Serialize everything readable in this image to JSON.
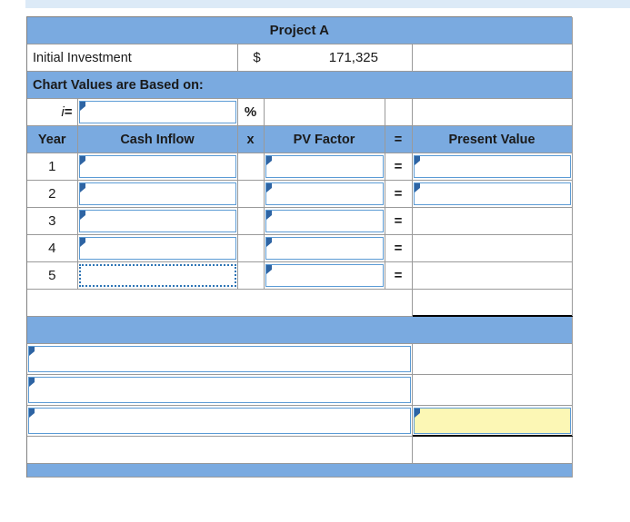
{
  "sheet": {
    "title": "Project A",
    "initial_investment": {
      "label": "Initial Investment",
      "currency_symbol": "$",
      "amount": "171,325"
    },
    "chart_values_note": "Chart Values are Based on:",
    "rate_row": {
      "label_i": "i",
      "label_eq": "=",
      "value": "",
      "unit": "%"
    },
    "columns": {
      "year": "Year",
      "cash_inflow": "Cash Inflow",
      "multiply": "x",
      "pv_factor": "PV Factor",
      "equals": "=",
      "present_value": "Present Value"
    },
    "rows": [
      {
        "year": "1",
        "cash_inflow": "",
        "op_x": "",
        "pv_factor": "",
        "op_eq": "=",
        "present_value": ""
      },
      {
        "year": "2",
        "cash_inflow": "",
        "op_x": "",
        "pv_factor": "",
        "op_eq": "=",
        "present_value": ""
      },
      {
        "year": "3",
        "cash_inflow": "",
        "op_x": "",
        "pv_factor": "",
        "op_eq": "=",
        "present_value": ""
      },
      {
        "year": "4",
        "cash_inflow": "",
        "op_x": "",
        "pv_factor": "",
        "op_eq": "=",
        "present_value": ""
      },
      {
        "year": "5",
        "cash_inflow": "",
        "op_x": "",
        "pv_factor": "",
        "op_eq": "=",
        "present_value": ""
      }
    ],
    "subtotal_row": {
      "label": "",
      "value": ""
    },
    "lower_band": {
      "label": ""
    },
    "lower_rows": [
      {
        "label": "",
        "value": ""
      },
      {
        "label": "",
        "value": ""
      },
      {
        "label": "",
        "value": ""
      }
    ],
    "final_row": {
      "label": "",
      "value": ""
    }
  },
  "colors": {
    "header_blue": "#7aaae0",
    "entry_border": "#5b9bd5",
    "marker": "#2e64a3",
    "highlight_yellow": "#fcf7b5",
    "top_strip": "#dceaf7",
    "grid_line": "#9a9a9a"
  }
}
